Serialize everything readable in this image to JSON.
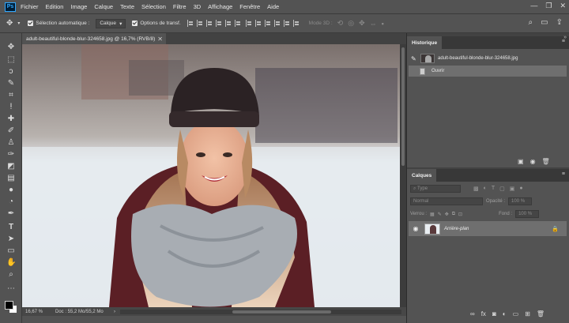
{
  "app": {
    "logo": "Ps"
  },
  "menu": [
    "Fichier",
    "Edition",
    "Image",
    "Calque",
    "Texte",
    "Sélection",
    "Filtre",
    "3D",
    "Affichage",
    "Fenêtre",
    "Aide"
  ],
  "window_controls": [
    "—",
    "❐",
    "✕"
  ],
  "options": {
    "auto_select_label": "Sélection automatique :",
    "auto_select_value": "Calque",
    "transform_label": "Options de transf.",
    "mode_3d_label": "Mode 3D :"
  },
  "document": {
    "tab_title": "adult-beautiful-blonde-blur-324658.jpg @ 16,7% (RVB/8)",
    "close_glyph": "✕",
    "zoom": "16,67 %",
    "doc_info": "Doc : 55,2 Mo/55,2 Mo"
  },
  "history_panel": {
    "title": "Historique",
    "snapshot_label": "adult-beautiful-blonde-blur-324658.jpg",
    "steps": [
      "Ouvrir"
    ]
  },
  "layers_panel": {
    "title": "Calques",
    "filter_placeholder": "Type",
    "blend_mode": "Normal",
    "opacity_label": "Opacité :",
    "opacity_value": "100 %",
    "lock_label": "Verrou :",
    "fill_label": "Fond :",
    "fill_value": "100 %",
    "layers": [
      {
        "name": "Arrière-plan",
        "visible": true,
        "locked": true
      }
    ]
  },
  "colors": {
    "ui_panel": "#535353",
    "ui_dark": "#424242",
    "selected_row": "#6f6f6f",
    "accent": "#31a8ff"
  },
  "icons": {
    "search": "search-icon",
    "workspace": "workspace-icon",
    "share": "share-icon",
    "eye": "eye-icon",
    "lock": "lock-icon",
    "camera": "camera-icon",
    "trash": "trash-icon"
  }
}
